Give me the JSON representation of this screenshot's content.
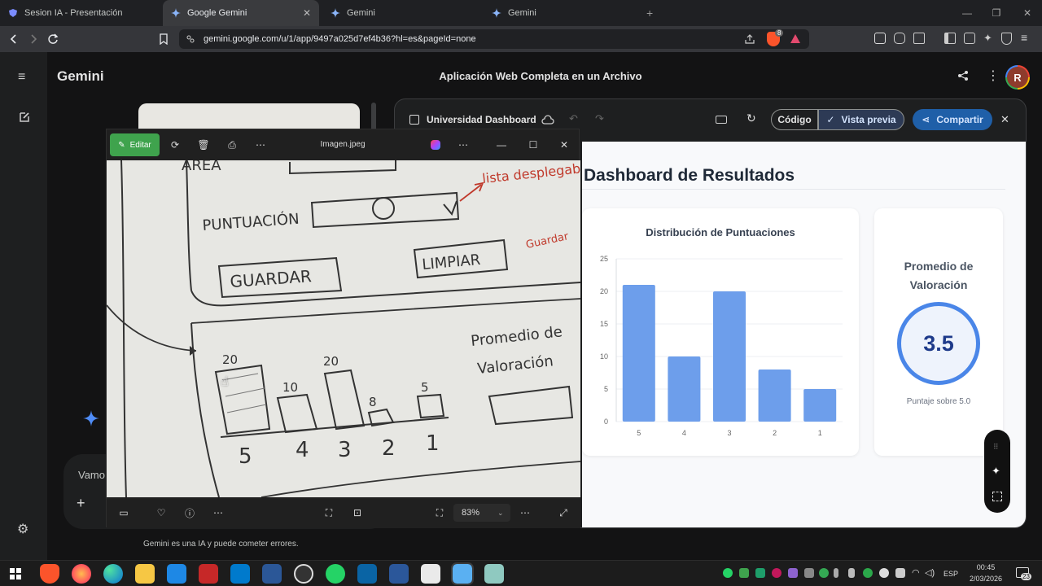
{
  "browser": {
    "tabs": [
      {
        "label": "Sesion IA - Presentación",
        "active": false
      },
      {
        "label": "Google Gemini",
        "active": true
      },
      {
        "label": "Gemini",
        "active": false
      },
      {
        "label": "Gemini",
        "active": false
      }
    ],
    "url": "gemini.google.com/u/1/app/9497a025d7ef4b36?hl=es&pageId=none",
    "brave_badge": "8"
  },
  "gemini": {
    "app_title": "Gemini",
    "conversation_title": "Aplicación Web Completa en un Archivo",
    "avatar_letter": "R",
    "composer_text": "Vamo",
    "disclaimer": "Gemini es una IA y puede cometer errores."
  },
  "canvas": {
    "title": "Universidad Dashboard",
    "code_label": "Código",
    "preview_label": "Vista previa",
    "share_label": "Compartir",
    "dashboard": {
      "heading": "Dashboard de Resultados",
      "average_title": "Promedio de Valoración",
      "average_value": "3.5",
      "average_caption": "Puntaje sobre 5.0"
    }
  },
  "chart_data": {
    "type": "bar",
    "title": "Distribución de Puntuaciones",
    "categories": [
      "5",
      "4",
      "3",
      "2",
      "1"
    ],
    "values": [
      21,
      10,
      20,
      8,
      5
    ],
    "ylim": [
      0,
      25
    ],
    "yticks": [
      "0",
      "5",
      "10",
      "15",
      "20",
      "25"
    ],
    "grid": true,
    "bar_color": "#6d9eeb"
  },
  "viewer": {
    "edit_label": "Editar",
    "filename": "Imagen.jpeg",
    "zoom": "83%",
    "sketch": {
      "field_label": "PUNTUACIÓN",
      "note_dropdown": "lista desplegable",
      "save_btn": "GUARDAR",
      "clear_btn": "LIMPIAR",
      "note_save": "Guardar",
      "avg_label_1": "Promedio de",
      "avg_label_2": "Valoración",
      "top_partial": "AREA",
      "bar_labels": [
        "20",
        "10",
        "20",
        "8",
        "5"
      ],
      "categories": [
        "5",
        "4",
        "3",
        "2",
        "1"
      ]
    }
  },
  "taskbar": {
    "lang": "ESP",
    "time": "00:45",
    "date": "2/03/2026",
    "notif_count": "23"
  }
}
